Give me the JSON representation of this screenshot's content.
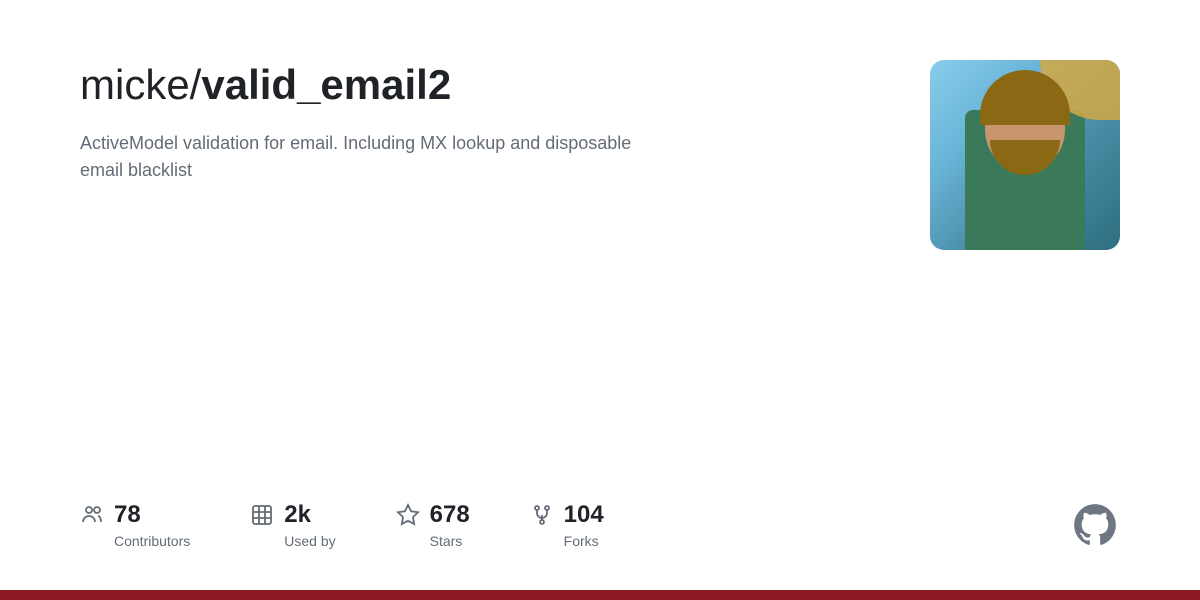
{
  "repo": {
    "owner": "micke/",
    "name": "valid_email2",
    "description": "ActiveModel validation for email. Including MX lookup and disposable email blacklist"
  },
  "stats": [
    {
      "id": "contributors",
      "value": "78",
      "label": "Contributors",
      "icon": "contributors-icon"
    },
    {
      "id": "used-by",
      "value": "2k",
      "label": "Used by",
      "icon": "used-by-icon"
    },
    {
      "id": "stars",
      "value": "678",
      "label": "Stars",
      "icon": "stars-icon"
    },
    {
      "id": "forks",
      "value": "104",
      "label": "Forks",
      "icon": "forks-icon"
    }
  ],
  "colors": {
    "bottom_bar": "#8b1a22",
    "text_primary": "#1f2328",
    "text_secondary": "#636c76",
    "github_icon": "#6e7781"
  }
}
